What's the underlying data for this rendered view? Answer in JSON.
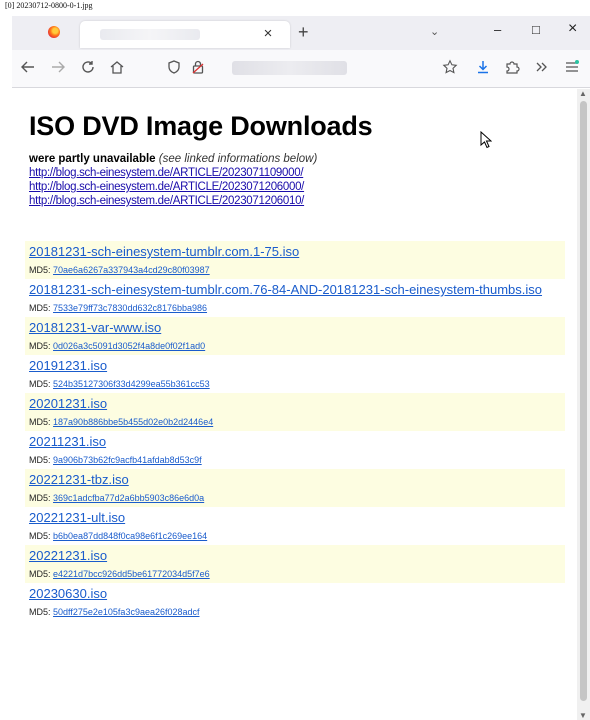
{
  "image_label": "[0] 20230712-0800-0-1.jpg",
  "browser": {
    "tab_close": "×",
    "new_tab": "+",
    "tab_list": "⌄",
    "window_minimize": "–",
    "window_maximize": "□",
    "window_close": "×",
    "toolbar_icons": {
      "back": "back-arrow-icon",
      "forward": "forward-arrow-icon",
      "reload": "reload-icon",
      "home": "home-icon",
      "tracking": "shield-icon",
      "lock": "lock-icon",
      "bookmark": "star-icon",
      "downloads": "download-icon",
      "extensions": "puzzle-icon",
      "overflow": "chevron-right-icon",
      "menu": "menu-icon"
    }
  },
  "page": {
    "title": "ISO DVD Image Downloads",
    "note_bold": "were partly unavailable",
    "note_italic": "(see linked informations below)",
    "articles": [
      "http://blog.sch-einesystem.de/ARTICLE/2023071109000/",
      "http://blog.sch-einesystem.de/ARTICLE/2023071206000/",
      "http://blog.sch-einesystem.de/ARTICLE/2023071206010/"
    ],
    "md5_label": "MD5:",
    "files": [
      {
        "name": "20181231-sch-einesystem-tumblr.com.1-75.iso",
        "md5": "70ae6a6267a337943a4cd29c80f03987"
      },
      {
        "name": "20181231-sch-einesystem-tumblr.com.76-84-AND-20181231-sch-einesystem-thumbs.iso",
        "md5": "7533e79ff73c7830dd632c8176bba986"
      },
      {
        "name": "20181231-var-www.iso",
        "md5": "0d026a3c5091d3052f4a8de0f02f1ad0"
      },
      {
        "name": "20191231.iso",
        "md5": "524b35127306f33d4299ea55b361cc53"
      },
      {
        "name": "20201231.iso",
        "md5": "187a90b886bbe5b455d02e0b2d2446e4"
      },
      {
        "name": "20211231.iso",
        "md5": "9a906b73b62fc9acfb41afdab8d53c9f"
      },
      {
        "name": "20221231-tbz.iso",
        "md5": "369c1adcfba77d2a6bb5903c86e6d0a"
      },
      {
        "name": "20221231-ult.iso",
        "md5": "b6b0ea87dd848f0ca98e6f1c269ee164"
      },
      {
        "name": "20221231.iso",
        "md5": "e4221d7bcc926dd5be61772034d5f7e6"
      },
      {
        "name": "20230630.iso",
        "md5": "50dff275e2e105fa3c9aea26f028adcf"
      }
    ]
  }
}
